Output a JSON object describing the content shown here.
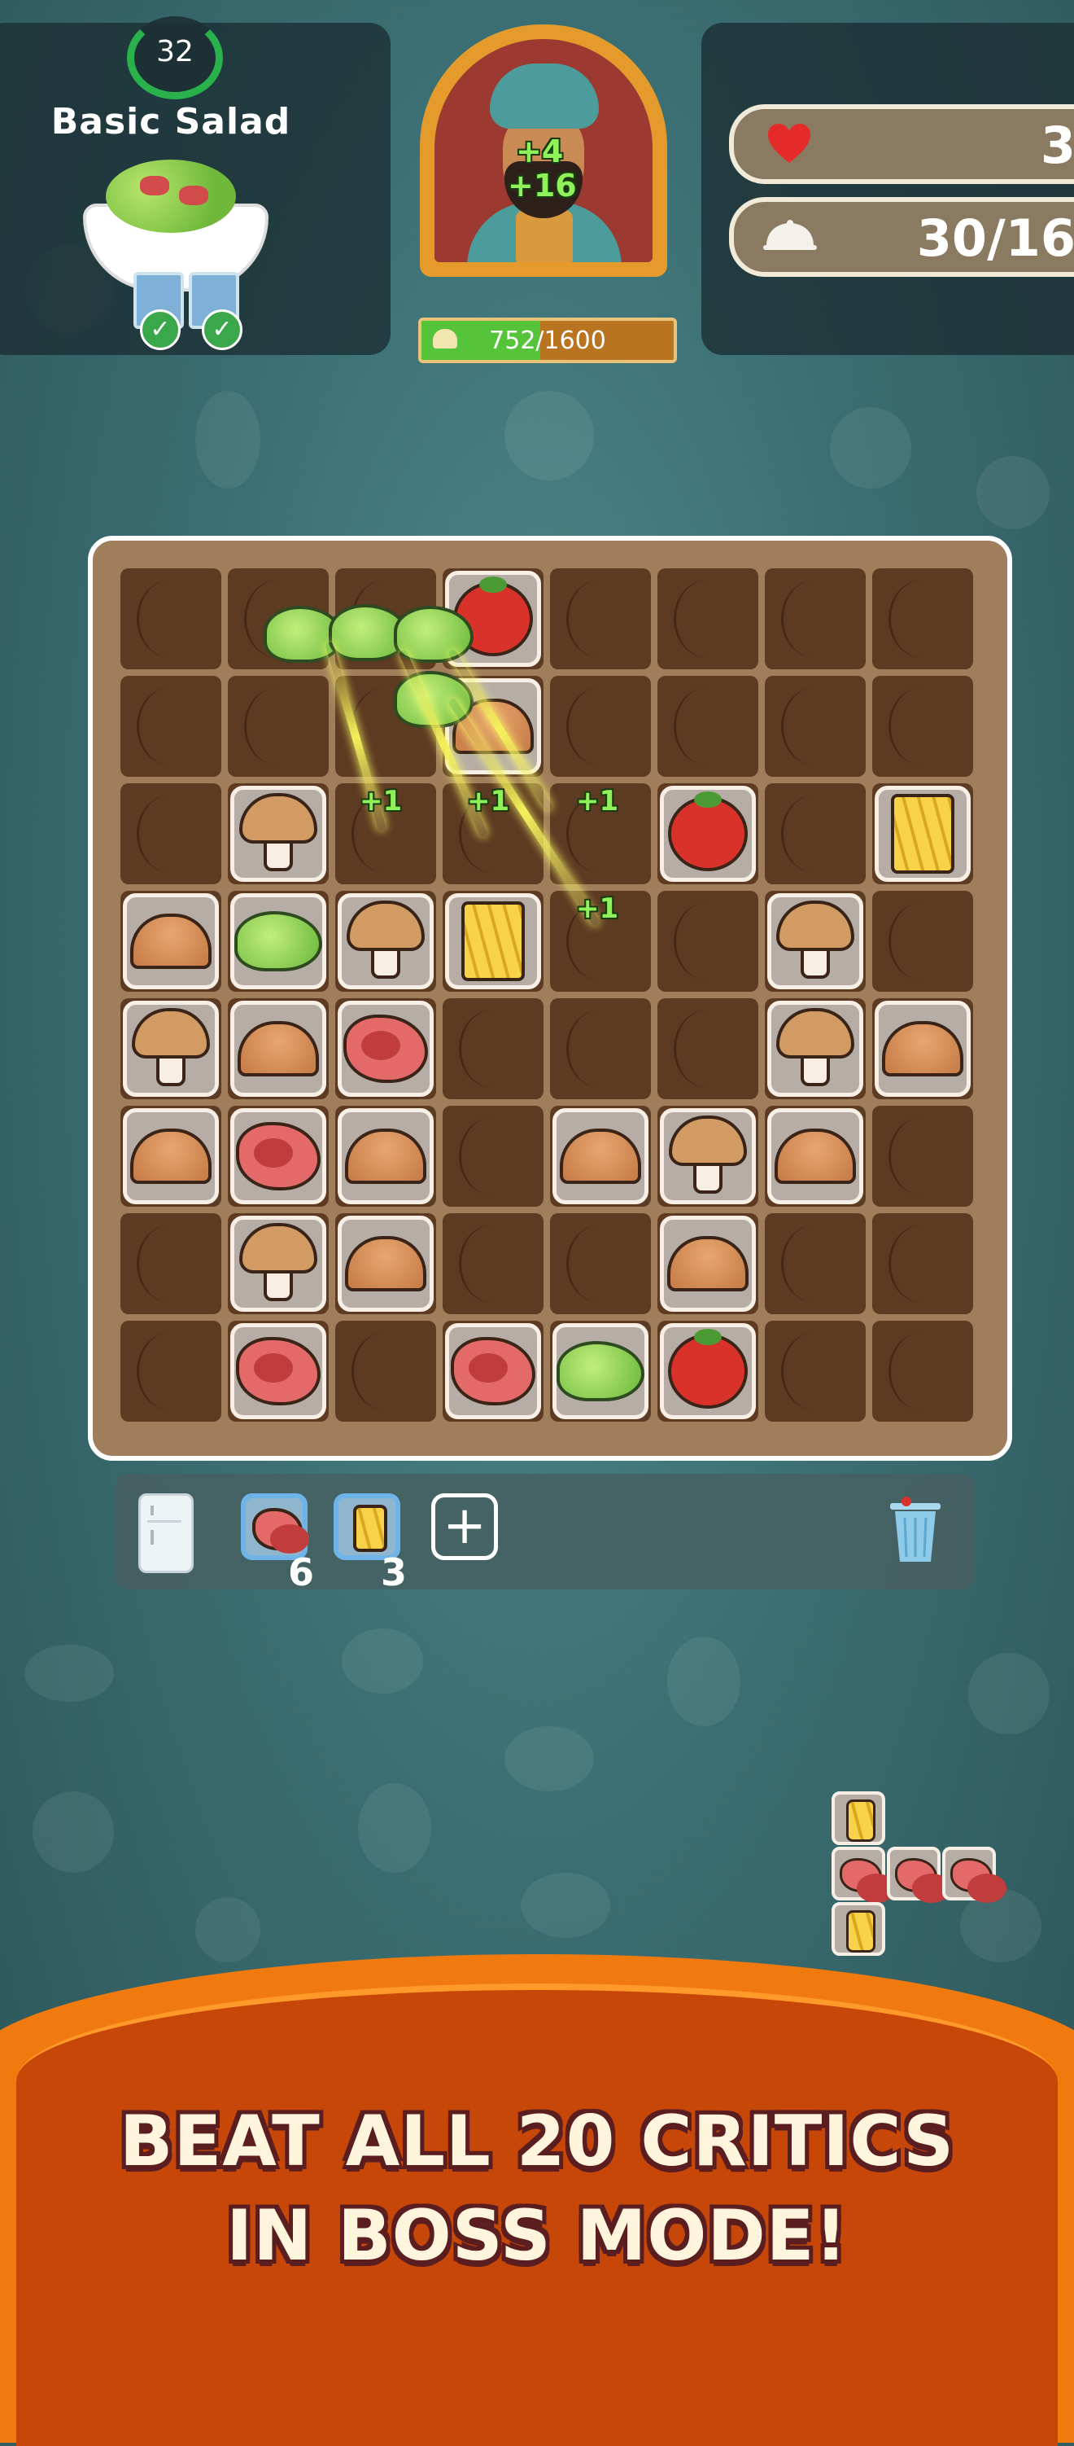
{
  "recipe": {
    "level": "32",
    "title": "Basic Salad"
  },
  "critic": {
    "score_pops": [
      "+4",
      "+16"
    ],
    "progress_text": "752/1600",
    "progress_fraction": 0.47
  },
  "stats": {
    "lives": "3",
    "dishes": "30/16"
  },
  "board": {
    "size": 8,
    "tiles": [
      {
        "r": 0,
        "c": 3,
        "item": "tomato"
      },
      {
        "r": 1,
        "c": 3,
        "item": "bun"
      },
      {
        "r": 2,
        "c": 1,
        "item": "mushroom"
      },
      {
        "r": 2,
        "c": 5,
        "item": "tomato"
      },
      {
        "r": 2,
        "c": 7,
        "item": "fries"
      },
      {
        "r": 3,
        "c": 0,
        "item": "bun"
      },
      {
        "r": 3,
        "c": 1,
        "item": "lettuce"
      },
      {
        "r": 3,
        "c": 2,
        "item": "mushroom"
      },
      {
        "r": 3,
        "c": 3,
        "item": "fries"
      },
      {
        "r": 3,
        "c": 6,
        "item": "mushroom"
      },
      {
        "r": 4,
        "c": 0,
        "item": "mushroom"
      },
      {
        "r": 4,
        "c": 1,
        "item": "bun"
      },
      {
        "r": 4,
        "c": 2,
        "item": "steak"
      },
      {
        "r": 4,
        "c": 6,
        "item": "mushroom"
      },
      {
        "r": 4,
        "c": 7,
        "item": "bun"
      },
      {
        "r": 5,
        "c": 0,
        "item": "bun"
      },
      {
        "r": 5,
        "c": 1,
        "item": "steak"
      },
      {
        "r": 5,
        "c": 2,
        "item": "bun"
      },
      {
        "r": 5,
        "c": 4,
        "item": "bun"
      },
      {
        "r": 5,
        "c": 5,
        "item": "mushroom"
      },
      {
        "r": 5,
        "c": 6,
        "item": "bun"
      },
      {
        "r": 6,
        "c": 1,
        "item": "mushroom"
      },
      {
        "r": 6,
        "c": 2,
        "item": "bun"
      },
      {
        "r": 6,
        "c": 5,
        "item": "bun"
      },
      {
        "r": 7,
        "c": 1,
        "item": "steak"
      },
      {
        "r": 7,
        "c": 3,
        "item": "steak"
      },
      {
        "r": 7,
        "c": 4,
        "item": "lettuce"
      },
      {
        "r": 7,
        "c": 5,
        "item": "tomato"
      }
    ],
    "plus_ones": [
      "+1",
      "+1",
      "+1",
      "+1"
    ]
  },
  "inventory": {
    "items": [
      {
        "item": "steak",
        "count": "6"
      },
      {
        "item": "fries",
        "count": "3"
      }
    ],
    "add_label": "+"
  },
  "next_piece": [
    "fries",
    "steak",
    "steak",
    "steak",
    "fries"
  ],
  "banner": {
    "line1": "BEAT ALL 20 CRITICS",
    "line2": "IN BOSS MODE!"
  },
  "colors": {
    "background": "#3b6f73",
    "board_wood": "#5d3a22",
    "banner_orange": "#f17a0f",
    "progress_green": "#55c43b",
    "score_green": "#8ff25a"
  }
}
